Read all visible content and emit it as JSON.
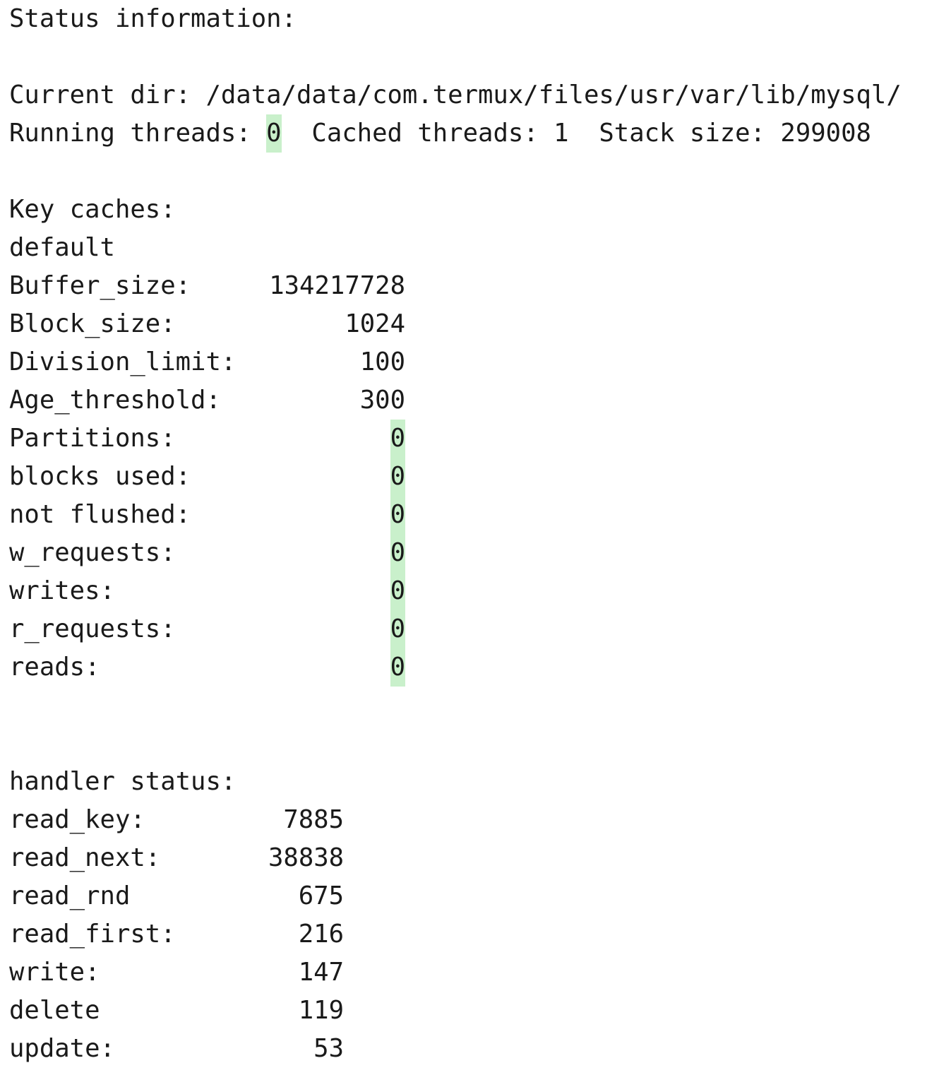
{
  "status_header": "Status information:",
  "current_dir_line": "Current dir: /data/data/com.termux/files/usr/var/lib/mysql/",
  "threads": {
    "running_label": "Running threads: ",
    "running_value": "0",
    "rest": "  Cached threads: 1  Stack size: 299008"
  },
  "key_caches": {
    "header": "Key caches:",
    "name": "default",
    "rows": [
      {
        "label": "Buffer_size:",
        "value": "134217728",
        "highlight": false
      },
      {
        "label": "Block_size:",
        "value": "1024",
        "highlight": false
      },
      {
        "label": "Division_limit:",
        "value": "100",
        "highlight": false
      },
      {
        "label": "Age_threshold:",
        "value": "300",
        "highlight": false
      },
      {
        "label": "Partitions:",
        "value": "0",
        "highlight": true
      },
      {
        "label": "blocks used:",
        "value": "0",
        "highlight": true
      },
      {
        "label": "not flushed:",
        "value": "0",
        "highlight": true
      },
      {
        "label": "w_requests:",
        "value": "0",
        "highlight": true
      },
      {
        "label": "writes:",
        "value": "0",
        "highlight": true
      },
      {
        "label": "r_requests:",
        "value": "0",
        "highlight": true
      },
      {
        "label": "reads:",
        "value": "0",
        "highlight": true
      }
    ]
  },
  "handler_status": {
    "header": "handler status:",
    "rows": [
      {
        "label": "read_key:",
        "value": "7885"
      },
      {
        "label": "read_next:",
        "value": "38838"
      },
      {
        "label": "read_rnd",
        "value": "675"
      },
      {
        "label": "read_first:",
        "value": "216"
      },
      {
        "label": "write:",
        "value": "147"
      },
      {
        "label": "delete",
        "value": "119"
      },
      {
        "label": "update:",
        "value": "53"
      }
    ]
  },
  "colors": {
    "text": "#1a1a1a",
    "highlight": "#c9f0cb",
    "background": "#ffffff"
  }
}
